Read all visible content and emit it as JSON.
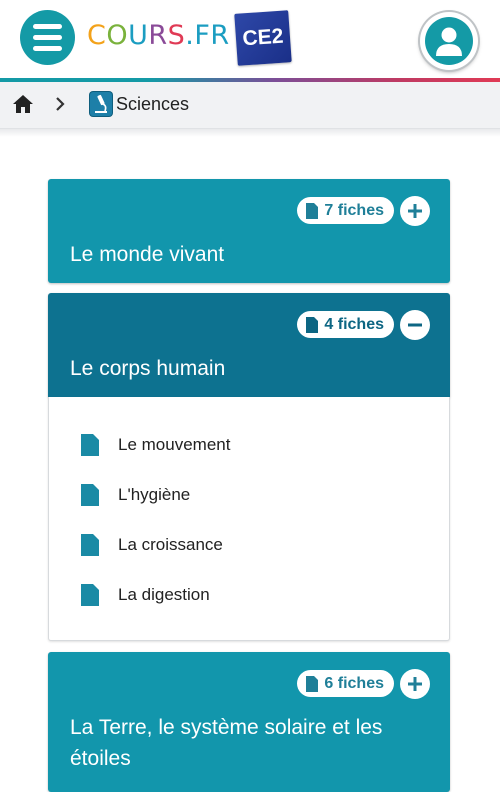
{
  "header": {
    "logo": {
      "part1": "C",
      "part2": "O",
      "part3": "U",
      "part4": "R",
      "part5": "S",
      "part6": ".FR"
    },
    "level_badge": "CE2",
    "menu_icon": "hamburger-menu-icon",
    "avatar_icon": "user-icon"
  },
  "breadcrumb": {
    "home_icon": "home-icon",
    "separator_icon": "chevron-right-icon",
    "section_icon": "microscope-icon",
    "section_label": "Sciences"
  },
  "colors": {
    "teal": "#1296ac",
    "teal_active": "#0d7290",
    "accent": "#149aa6"
  },
  "themes": [
    {
      "title": "Le monde vivant",
      "count_label": "7 fiches",
      "expanded": false
    },
    {
      "title": "Le corps humain",
      "count_label": "4 fiches",
      "expanded": true,
      "fiches": [
        "Le mouvement",
        "L'hygiène",
        "La croissance",
        "La digestion"
      ]
    },
    {
      "title_line1": "La Terre, le système solaire et les",
      "title_line2": "étoiles",
      "count_label": "6 fiches",
      "expanded": false
    }
  ]
}
